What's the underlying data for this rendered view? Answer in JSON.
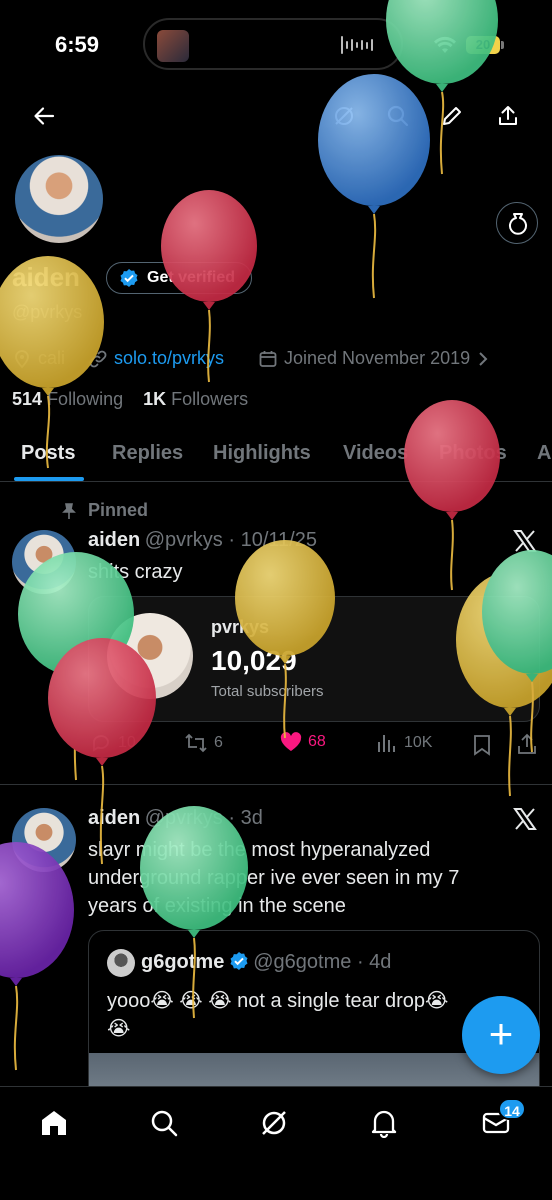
{
  "status": {
    "time": "6:59",
    "battery": "20"
  },
  "profile": {
    "name": "aiden",
    "handle": "@pvrkys",
    "get_verified": "Get verified",
    "location": "cali",
    "website": "solo.to/pvrkys",
    "joined": "Joined November 2019",
    "following_count": "514",
    "following_label": "Following",
    "followers_count": "1K",
    "followers_label": "Followers"
  },
  "tabs": [
    "Posts",
    "Replies",
    "Highlights",
    "Videos",
    "Photos",
    "A"
  ],
  "post1": {
    "pinned_label": "Pinned",
    "name": "aiden",
    "handle": "@pvrkys",
    "date": "10/11/25",
    "text": "shits crazy",
    "card": {
      "title": "pvrkys",
      "number": "10,029",
      "subtitle": "Total subscribers"
    },
    "replies": "10",
    "reposts": "6",
    "likes": "68",
    "views": "10K"
  },
  "post2": {
    "name": "aiden",
    "handle": "@pvrkys",
    "date": "3d",
    "text_line1": "slayr might be the most hyperanalyzed",
    "text_line2": "underground rapper ive ever seen in my 7",
    "text_line3": "years of existing in the scene",
    "quote": {
      "name": "g6gotme",
      "handle": "@g6gotme",
      "date": "4d",
      "text_line1": "yooo😭 😭 😭 not a single tear drop😭",
      "text_line2": "😭"
    }
  },
  "nav": {
    "messages_badge": "14"
  },
  "colors": {
    "accent": "#1d9bf0",
    "like": "#f91880",
    "background": "#000000"
  }
}
